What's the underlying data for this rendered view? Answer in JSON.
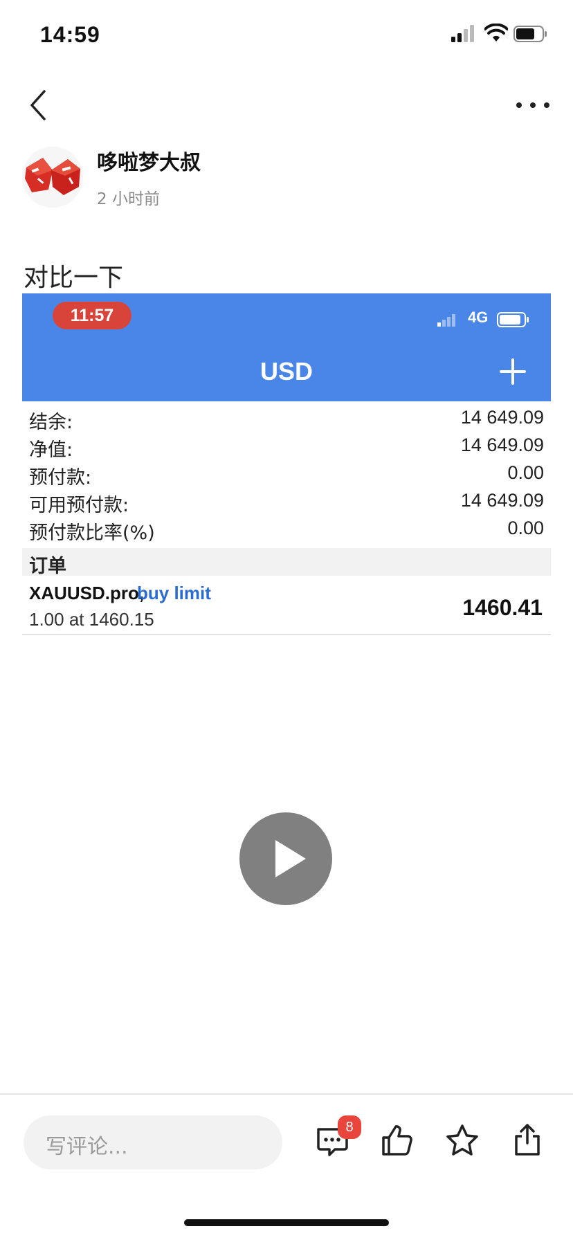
{
  "status_bar": {
    "time": "14:59"
  },
  "author": {
    "name": "哆啦梦大叔",
    "time": "2 小时前"
  },
  "post": {
    "text": "对比一下"
  },
  "screenshot": {
    "status_time": "11:57",
    "network": "4G",
    "title": "USD",
    "account": [
      {
        "label": "结余:",
        "value": "14 649.09"
      },
      {
        "label": "净值:",
        "value": "14 649.09"
      },
      {
        "label": "预付款:",
        "value": "0.00"
      },
      {
        "label": "可用预付款:",
        "value": "14 649.09"
      },
      {
        "label": "预付款比率(%)",
        "value": "0.00"
      }
    ],
    "orders_header": "订单",
    "order": {
      "symbol": "XAUUSD.pro,",
      "type": "buy limit",
      "detail": "1.00 at 1460.15",
      "price": "1460.41"
    }
  },
  "bottom_bar": {
    "comment_placeholder": "写评论...",
    "comment_count": "8",
    "icons": [
      "comment-icon",
      "like-icon",
      "star-icon",
      "share-icon"
    ]
  },
  "colors": {
    "header_blue": "#4a86e8",
    "pill_red": "#d8443a",
    "badge_red": "#e8453c",
    "order_type_blue": "#2a6ccf"
  }
}
